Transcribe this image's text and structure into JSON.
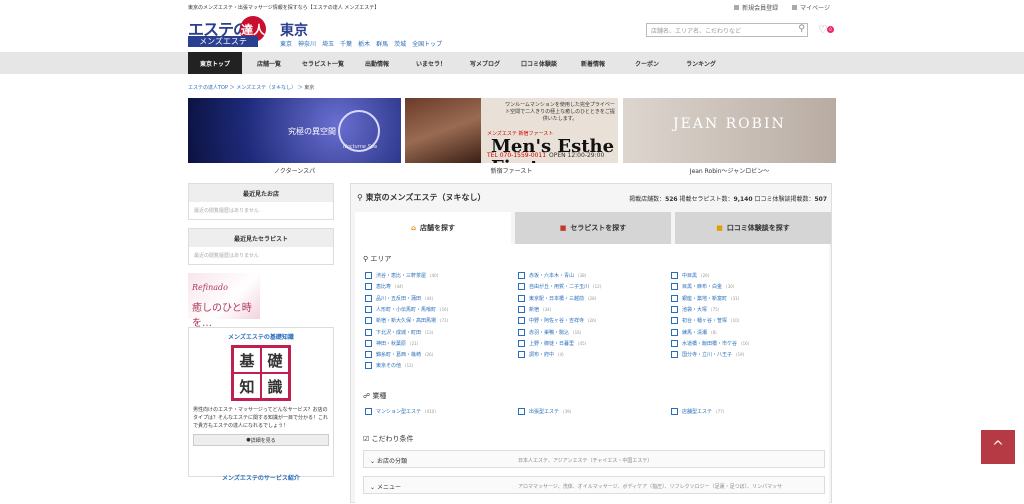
{
  "header": {
    "tagline": "東京のメンズエステ・出張マッサージ情報を探すなら【エステの達人 メンズエステ】",
    "logo_top": "エステの",
    "logo_circle": "達人",
    "logo_bottom": "メンズエステ",
    "prefecture": "東京",
    "cities": [
      "東京",
      "神奈川",
      "埼玉",
      "千葉",
      "栃木",
      "群馬",
      "茨城",
      "全国トップ"
    ],
    "links": {
      "register": "新規会員登録",
      "mypage": "マイページ"
    },
    "search_placeholder": "店舗名、エリア名、こだわりなど",
    "fav_count": "0"
  },
  "nav": [
    "東京トップ",
    "店舗一覧",
    "セラピスト一覧",
    "出勤情報",
    "いまセラ！",
    "写メブログ",
    "口コミ体験談",
    "新着情報",
    "クーポン",
    "ランキング"
  ],
  "breadcrumb": {
    "items": [
      "エステの達人TOP",
      "メンズエステ（ヌキなし）"
    ],
    "current": "東京"
  },
  "banners": [
    {
      "caption": "ノクターンスパ",
      "text": "究極の異空間",
      "brand": "Nocturne Spa"
    },
    {
      "caption": "新宿ファースト",
      "text": "ワンルームマンションを使用した完全プライベート空間で二人きりの極上な癒しのひとときをご提供いたします。",
      "brand": "Men's Esthe First",
      "sub": "メンズエステ 新宿ファースト",
      "tel": "TEL 070-1559-0011",
      "open": "OPEN 12:00-29:00"
    },
    {
      "caption": "Jean Robin〜ジャンロビン〜",
      "brand": "JEAN ROBIN"
    }
  ],
  "sidebar": {
    "recent_shops_title": "最近見たお店",
    "recent_shops_empty": "最近の閲覧履歴はありません",
    "recent_therapists_title": "最近見たセラピスト",
    "recent_therapists_empty": "最近の閲覧履歴はありません",
    "ad_text1": "Refinado",
    "ad_text2": "癒しのひと時を…",
    "basics_title": "メンズエステの基礎知識",
    "basics_chars": [
      "基",
      "礎",
      "知",
      "識"
    ],
    "basics_desc": "男性向けのエステ・マッサージってどんなサービス？お店のタイプは？そんなエステに関する知識が一目で分かる！これで貴方もエステの達人になれるでしょう！",
    "basics_button": "詳細を見る",
    "service_title": "メンズエステのサービス紹介"
  },
  "main": {
    "title": "東京のメンズエステ（ヌキなし）",
    "stats": {
      "shops_label": "掲載店舗数：",
      "shops": "526",
      "therapists_label": "掲載セラピスト数：",
      "therapists": "9,140",
      "reviews_label": "口コミ体験談掲載数：",
      "reviews": "507"
    },
    "tabs": [
      "店舗を探す",
      "セラピストを探す",
      "口コミ体験談を探す"
    ],
    "area_label": "エリア",
    "areas": [
      [
        "渋谷・恵比・三軒茶屋",
        "(40)"
      ],
      [
        "赤坂・六本木・青山",
        "(38)"
      ],
      [
        "中目黒",
        "(26)"
      ],
      [
        "恵比寿",
        "(44)"
      ],
      [
        "自由が丘・用賀・二子玉川",
        "(12)"
      ],
      [
        "目黒・麻布・白金",
        "(30)"
      ],
      [
        "品川・五反田・蒲田",
        "(44)"
      ],
      [
        "東京駅・日本橋・三越前",
        "(28)"
      ],
      [
        "銀座・築地・新富町",
        "(31)"
      ],
      [
        "人形町・小伝馬町・馬喰町",
        "(16)"
      ],
      [
        "新宿",
        "(34)"
      ],
      [
        "池袋・大塚",
        "(75)"
      ],
      [
        "新宿・新大久保・高田馬場",
        "(71)"
      ],
      [
        "中野・阿佐ヶ谷・吉祥寺",
        "(26)"
      ],
      [
        "初台・幡ヶ谷・笹塚",
        "(10)"
      ],
      [
        "下北沢・成城・町田",
        "(13)"
      ],
      [
        "赤羽・巣鴨・駒込",
        "(16)"
      ],
      [
        "練馬・清瀬",
        "(8)"
      ],
      [
        "神田・秋葉原",
        "(21)"
      ],
      [
        "上野・御徒・日暮里",
        "(45)"
      ],
      [
        "水道橋・飯田橋・市ケ谷",
        "(16)"
      ],
      [
        "錦糸町・葛西・篠崎",
        "(26)"
      ],
      [
        "調布・府中",
        "(4)"
      ],
      [
        "国分寺・立川・八王子",
        "(19)"
      ],
      [
        "東京その他",
        "(12)"
      ]
    ],
    "type_label": "業種",
    "types": [
      [
        "マンション型エステ",
        "(410)"
      ],
      [
        "出張型エステ",
        "(39)"
      ],
      [
        "店舗型エステ",
        "(77)"
      ]
    ],
    "cond_label": "こだわり条件",
    "cond_rows": [
      {
        "label": "お店の分類",
        "value": "日本人エステ、アジアンエステ（チャイエス・中国エステ）"
      },
      {
        "label": "メニュー",
        "value": "アロママッサージ、洗体、オイルマッサージ、ボディケア（指圧）、リフレクソロジー（足裏・足つぼ）、リンパマッサ"
      }
    ]
  },
  "totop": "^"
}
